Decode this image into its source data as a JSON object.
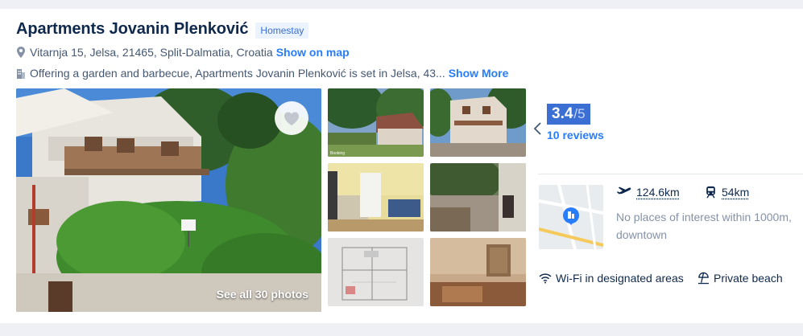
{
  "hotel": {
    "name": "Apartments Jovanin Plenković",
    "type_badge": "Homestay",
    "address": "Vitarnja 15, Jelsa, 21465, Split-Dalmatia, Croatia",
    "show_on_map": "Show on map",
    "description": "Offering a garden and barbecue, Apartments Jovanin Plenković is set in Jelsa, 43...",
    "show_more": "Show More"
  },
  "gallery": {
    "see_all": "See all 30 photos",
    "thumb_watermark": "Booking"
  },
  "rating": {
    "score": "3.4",
    "out_of": "/5",
    "reviews": "10 reviews"
  },
  "location": {
    "airport_distance": "124.6km",
    "station_distance": "54km",
    "poi_text": "No places of interest within 1000m, downtown"
  },
  "amenities": [
    {
      "label": "Wi-Fi in designated areas",
      "icon": "wifi-icon"
    },
    {
      "label": "Private beach",
      "icon": "beach-umbrella-icon"
    }
  ],
  "colors": {
    "accent": "#287dfa",
    "score_bg": "#3b6fd4",
    "title": "#0f294d",
    "muted": "#8592a6"
  }
}
